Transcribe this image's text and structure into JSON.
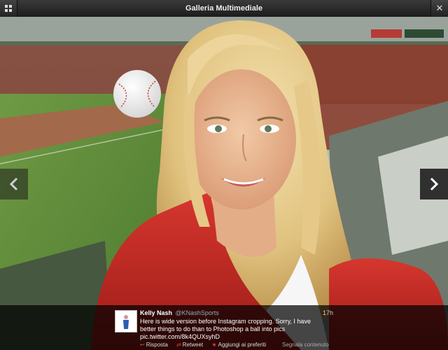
{
  "window": {
    "title": "Galleria Multimediale",
    "grid_icon": "grid-icon",
    "close_icon": "close-icon"
  },
  "navigation": {
    "prev_icon": "chevron-left-icon",
    "next_icon": "chevron-right-icon"
  },
  "tweet": {
    "name": "Kelly Nash",
    "handle": "@KNashSports",
    "time": "17h",
    "text_line1": "Here is wide version before Instagram cropping. Sorry, I have",
    "text_line2": "better things to do than to Photoshop a ball into pics",
    "text_line3": "pic.twitter.com/8k4QUXsyhD",
    "actions": {
      "reply": "Risposta",
      "retweet": "Retweet",
      "favorite": "Aggiungi ai preferiti",
      "report": "Segnala contenuto"
    }
  },
  "colors": {
    "titlebar": "#2a2a2a",
    "jacket": "#c42a25",
    "grass": "#5f8d3a",
    "seats": "#7a3a2a"
  }
}
